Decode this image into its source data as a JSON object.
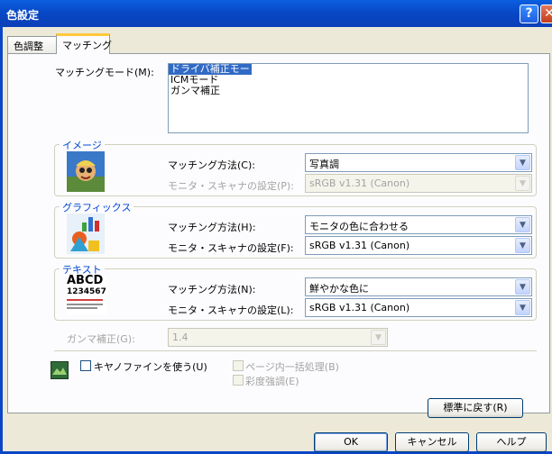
{
  "window": {
    "title": "色設定"
  },
  "tabs": [
    {
      "label": "色調整"
    },
    {
      "label": "マッチング"
    }
  ],
  "matching_mode": {
    "label": "マッチングモード(M):",
    "options": [
      "ドライバ補正モード",
      "ICMモード",
      "ガンマ補正"
    ],
    "selected": "ドライバ補正モード"
  },
  "image_group": {
    "title": "イメージ",
    "method_label": "マッチング方法(C):",
    "method_value": "写真調",
    "monitor_label": "モニタ・スキャナの設定(P):",
    "monitor_value": "sRGB v1.31 (Canon)"
  },
  "graphics_group": {
    "title": "グラフィックス",
    "method_label": "マッチング方法(H):",
    "method_value": "モニタの色に合わせる",
    "monitor_label": "モニタ・スキャナの設定(F):",
    "monitor_value": "sRGB v1.31 (Canon)"
  },
  "text_group": {
    "title": "テキスト",
    "thumb_line1": "ABCD",
    "thumb_line2": "1234567",
    "method_label": "マッチング方法(N):",
    "method_value": "鮮やかな色に",
    "monitor_label": "モニタ・スキャナの設定(L):",
    "monitor_value": "sRGB v1.31 (Canon)"
  },
  "gamma": {
    "label": "ガンマ補正(G):",
    "value": "1.4"
  },
  "checks": {
    "canon_fine": "キヤノファインを使う(U)",
    "page_batch": "ページ内一括処理(B)",
    "saturation": "彩度強調(E)"
  },
  "buttons": {
    "reset": "標準に戻す(R)",
    "ok": "OK",
    "cancel": "キャンセル",
    "help": "ヘルプ"
  },
  "icons": {
    "help": "?",
    "close": "✕",
    "dropdown": "▼"
  }
}
